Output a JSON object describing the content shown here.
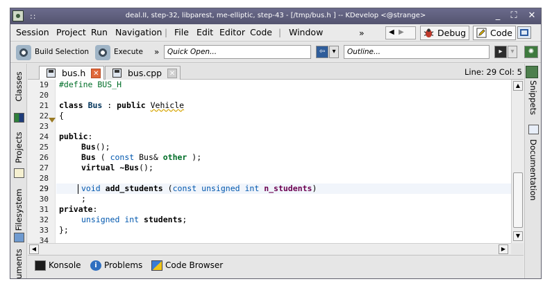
{
  "window": {
    "title": "deal.II, step-32, libparest, me-elliptic, step-43 - [/tmp/bus.h ] -- KDevelop <@strange>",
    "title_dots": "::",
    "controls": {
      "minimize": "_",
      "maximize": "⛶",
      "close": "✕"
    }
  },
  "menubar": {
    "items": [
      "Session",
      "Project",
      "Run",
      "Navigation",
      "File",
      "Edit",
      "Editor",
      "Code",
      "Window"
    ],
    "overflow": "»",
    "nav_back": "◀",
    "nav_forward": "▶",
    "areas": {
      "debug": "Debug",
      "code": "Code"
    }
  },
  "toolbar": {
    "build_selection": "Build Selection",
    "execute": "Execute",
    "overflow": "»",
    "quick_open_placeholder": "Quick Open...",
    "outline_placeholder": "Outline..."
  },
  "left_dock": {
    "tabs": [
      "Classes",
      "Projects",
      "Filesystem",
      "uments"
    ]
  },
  "right_dock": {
    "tabs": [
      "Snippets",
      "Documentation"
    ]
  },
  "editor": {
    "tabs": [
      {
        "label": "bus.h",
        "active": true
      },
      {
        "label": "bus.cpp",
        "active": false
      }
    ],
    "status": "Line: 29 Col: 5",
    "line_numbers": [
      "19",
      "20",
      "21",
      "22",
      "23",
      "24",
      "25",
      "26",
      "27",
      "28",
      "29",
      "30",
      "31",
      "32",
      "33",
      "34"
    ],
    "current_line": "29",
    "code": {
      "l19": "#define BUS_H",
      "l21_kw": "class",
      "l21_name": "Bus",
      "l21_sep": " : ",
      "l21_public": "public",
      "l21_base": "Vehicle",
      "l22": "{",
      "l24_kw": "public",
      "l24_colon": ":",
      "l25_name": "Bus",
      "l25_rest": "();",
      "l26_name": "Bus",
      "l26_p1": " ( ",
      "l26_const": "const",
      "l26_type": " Bus& ",
      "l26_param": "other",
      "l26_end": " );",
      "l27_kw": "virtual",
      "l27_name": " ~Bus",
      "l27_rest": "();",
      "l29_type": "void",
      "l29_name": "add_students",
      "l29_open": " (",
      "l29_const": "const",
      "l29_sp1": " ",
      "l29_unsigned": "unsigned",
      "l29_sp2": " ",
      "l29_int": "int",
      "l29_param": " n_students",
      "l29_close": ")",
      "l30": ";",
      "l31_kw": "private",
      "l31_colon": ":",
      "l32_unsigned": "unsigned",
      "l32_sp": " ",
      "l32_int": "int",
      "l32_var": " students",
      "l32_end": ";",
      "l33": "};"
    }
  },
  "bottom_dock": {
    "tabs": [
      "Konsole",
      "Problems",
      "Code Browser"
    ]
  },
  "colors": {
    "accent": "#0057ae",
    "preprocessor": "#006e28",
    "tab_close": "#e0683a",
    "titlebar": "#5f5f7d"
  }
}
